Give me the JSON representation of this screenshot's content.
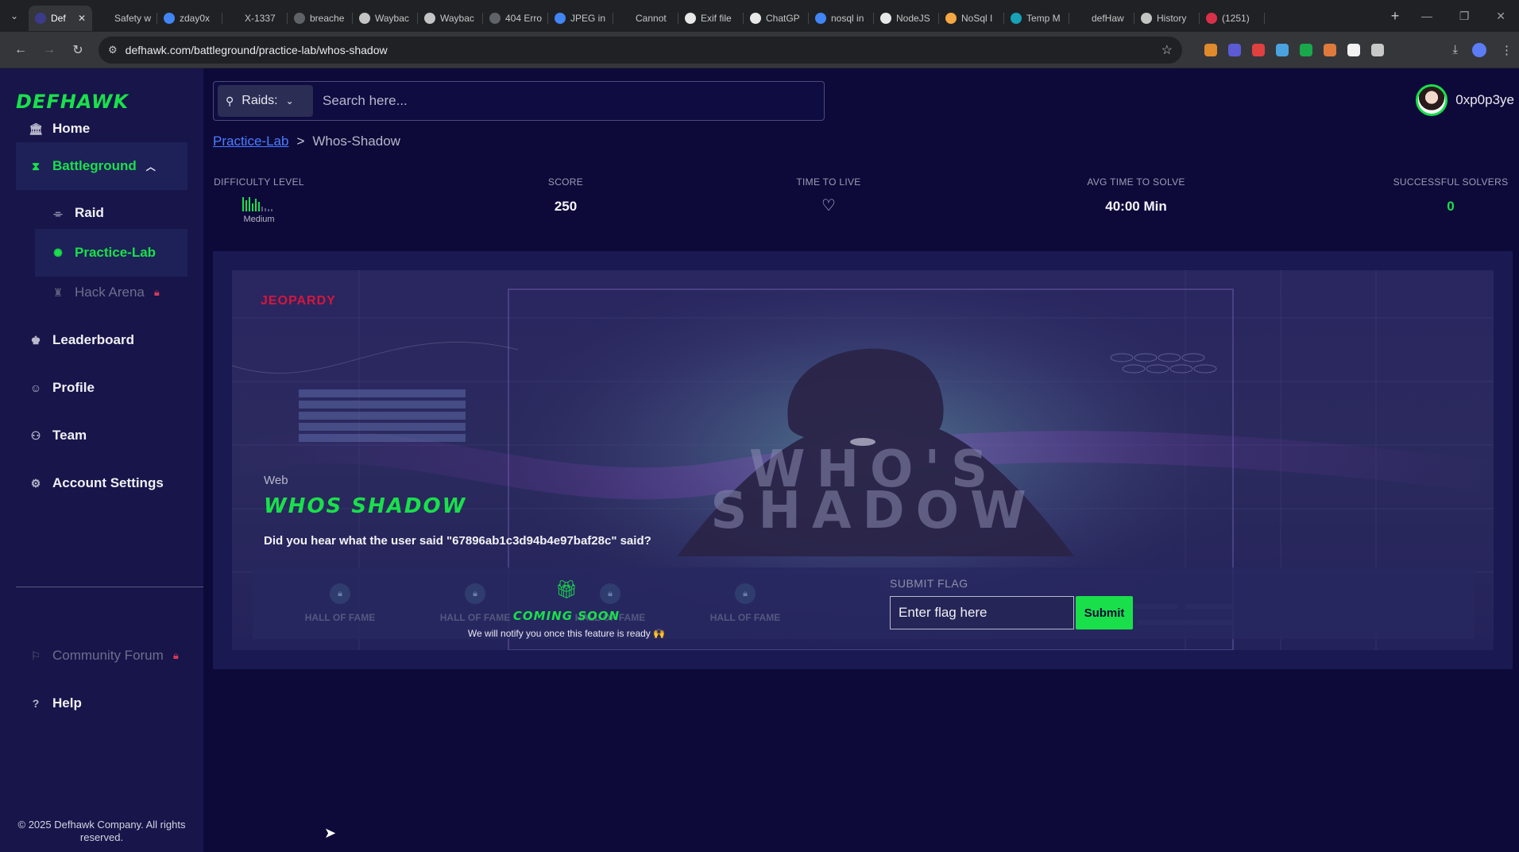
{
  "browser": {
    "tabs": [
      {
        "label": "Def",
        "color": "#3b3b8a",
        "active": true
      },
      {
        "label": "Safety warn",
        "color": "#202124"
      },
      {
        "label": "zday0x",
        "color": "#4285f4"
      },
      {
        "label": "X-1337",
        "color": "#202124"
      },
      {
        "label": "breache",
        "color": "#5f6368"
      },
      {
        "label": "Waybac",
        "color": "#c4c4c4"
      },
      {
        "label": "Waybac",
        "color": "#c4c4c4"
      },
      {
        "label": "404 Erro",
        "color": "#5f6368"
      },
      {
        "label": "JPEG in",
        "color": "#4285f4"
      },
      {
        "label": "Cannot",
        "color": "#202124"
      },
      {
        "label": "Exif file",
        "color": "#e8e8e8"
      },
      {
        "label": "ChatGP",
        "color": "#e8e8e8"
      },
      {
        "label": "nosql in",
        "color": "#4285f4"
      },
      {
        "label": "NodeJS",
        "color": "#e8e8e8"
      },
      {
        "label": "NoSql I",
        "color": "#f4a742"
      },
      {
        "label": "Temp M",
        "color": "#17a2b8"
      },
      {
        "label": "defHaw",
        "color": "#202124"
      },
      {
        "label": "History",
        "color": "#c4c4c4"
      },
      {
        "label": "(1251)",
        "color": "#d9304a"
      }
    ],
    "url": "defhawk.com/battleground/practice-lab/whos-shadow",
    "extension_colors": [
      "#e08a2c",
      "#5b5bd6",
      "#e04040",
      "#4aa3df",
      "#19a84a",
      "#e07a3c",
      "#f2f2f2",
      "#c8c8c8"
    ]
  },
  "sidebar": {
    "logo": "DEFHAWK",
    "items": [
      {
        "label": "Home",
        "icon": "bank-icon"
      },
      {
        "label": "Battleground",
        "icon": "hourglass-icon"
      },
      {
        "label": "Raid",
        "icon": "raid-icon"
      },
      {
        "label": "Practice-Lab",
        "icon": "atom-icon"
      },
      {
        "label": "Hack Arena",
        "icon": "arena-icon"
      },
      {
        "label": "Leaderboard",
        "icon": "trophy-icon"
      },
      {
        "label": "Profile",
        "icon": "profile-icon"
      },
      {
        "label": "Team",
        "icon": "team-icon"
      },
      {
        "label": "Account Settings",
        "icon": "gear-icon"
      },
      {
        "label": "Community Forum",
        "icon": "forum-icon"
      },
      {
        "label": "Help",
        "icon": "help-icon"
      }
    ],
    "copyright": "© 2025 Defhawk Company. All rights reserved."
  },
  "header": {
    "search_filter": "Raids:",
    "search_placeholder": "Search here...",
    "username": "0xp0p3ye"
  },
  "breadcrumb": {
    "parent": "Practice-Lab",
    "separator": ">",
    "current": "Whos-Shadow"
  },
  "stats": {
    "difficulty_label": "DIFFICULTY LEVEL",
    "difficulty_value": "Medium",
    "score_label": "SCORE",
    "score_value": "250",
    "ttl_label": "TIME TO LIVE",
    "avg_label": "AVG TIME TO SOLVE",
    "avg_value": "40:00 Min",
    "solvers_label": "SUCCESSFUL SOLVERS",
    "solvers_value": "0"
  },
  "challenge": {
    "type": "JEOPARDY",
    "category": "Web",
    "title": "WHOS SHADOW",
    "description": "Did you hear what the user said \"67896ab1c3d94b4e97baf28c\" said?",
    "art_title_line1": "WHO'S",
    "art_title_line2": "SHADOW"
  },
  "hall_of_fame": {
    "label": "HALL OF FAME",
    "coming_soon": "COMING SOON",
    "notice": "We will notify you once this feature is ready 🙌"
  },
  "flag": {
    "label": "SUBMIT FLAG",
    "placeholder": "Enter flag here",
    "submit": "Submit"
  }
}
